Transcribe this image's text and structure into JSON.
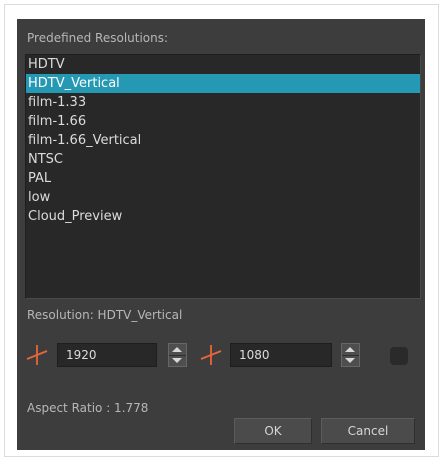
{
  "dialog": {
    "list_title": "Predefined Resolutions:",
    "resolutions": [
      "HDTV",
      "HDTV_Vertical",
      "film-1.33",
      "film-1.66",
      "film-1.66_Vertical",
      "NTSC",
      "PAL",
      "low",
      "Cloud_Preview"
    ],
    "selected_index": 1,
    "resolution_label": "Resolution:  HDTV_Vertical",
    "width_value": "1920",
    "height_value": "1080",
    "aspect_ratio_label": "Aspect Ratio : 1.778",
    "ok_label": "OK",
    "cancel_label": "Cancel"
  },
  "colors": {
    "selection": "#2599b4",
    "crosshair": "#e8663a"
  },
  "icons": {
    "width": "crosshair-icon",
    "height": "crosshair-icon",
    "lock": "aspect-lock-icon"
  }
}
